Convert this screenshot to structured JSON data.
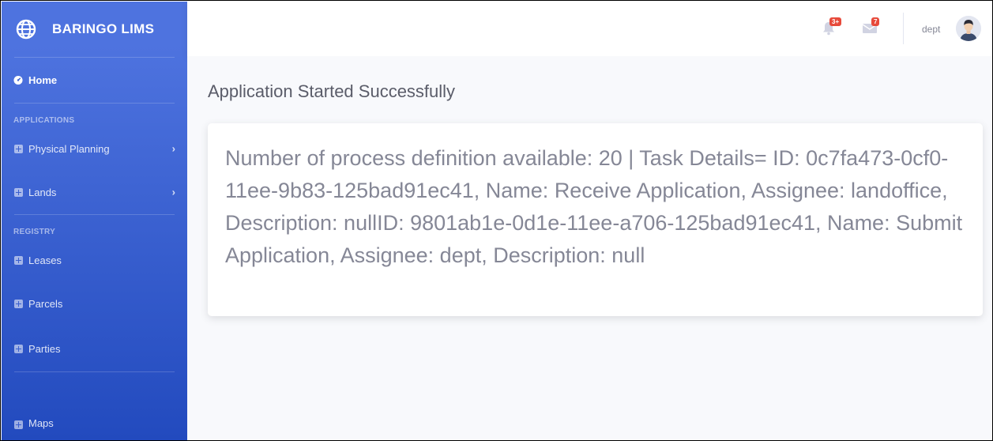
{
  "brand": {
    "name": "BARINGO LIMS",
    "icon": "globe-icon"
  },
  "sidebar": {
    "home": {
      "label": "Home",
      "icon": "dashboard-icon"
    },
    "sections": [
      {
        "heading": "APPLICATIONS"
      },
      {
        "heading": "REGISTRY"
      }
    ],
    "items": [
      {
        "label": "Physical Planning",
        "has_submenu": true
      },
      {
        "label": "Lands",
        "has_submenu": true
      },
      {
        "label": "Leases",
        "has_submenu": false
      },
      {
        "label": "Parcels",
        "has_submenu": false
      },
      {
        "label": "Parties",
        "has_submenu": false
      },
      {
        "label": "Maps",
        "has_submenu": false
      }
    ]
  },
  "topbar": {
    "alerts_badge": "3+",
    "messages_badge": "7",
    "username": "dept"
  },
  "main": {
    "title": "Application Started Successfully",
    "message": "Number of process definition available: 20 | Task Details= ID: 0c7fa473-0cf0-11ee-9b83-125bad91ec41, Name: Receive Application, Assignee: landoffice, Description: nullID: 9801ab1e-0d1e-11ee-a706-125bad91ec41, Name: Submit Application, Assignee: dept, Description: null"
  },
  "colors": {
    "sidebar_top": "#4e73df",
    "sidebar_bottom": "#224abe",
    "badge": "#e74a3b",
    "text_muted": "#858796"
  }
}
